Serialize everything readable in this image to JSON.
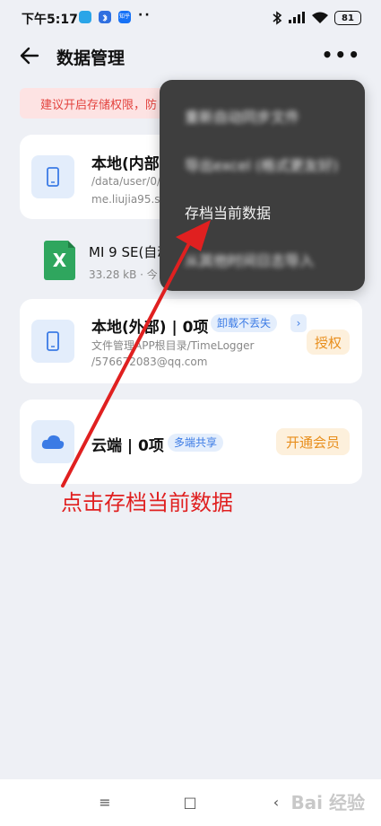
{
  "status_bar": {
    "time": "下午5:17",
    "dots": "··",
    "battery": "81",
    "app_icons": [
      "app-blue-icon",
      "bluetooth-notify-icon",
      "zhihu-icon"
    ],
    "zhihu_label": "知乎"
  },
  "header": {
    "title": "数据管理",
    "more": "•••"
  },
  "banner": {
    "text": "建议开启存储权限，防"
  },
  "cards": {
    "local_internal": {
      "title": "本地(内部",
      "path": "/data/user/0/",
      "package": "me.liujia95.so"
    },
    "file": {
      "name": "MI 9 SE(自动",
      "meta": "33.28 kB · 今",
      "icon_letter": "X"
    },
    "local_external": {
      "title": "本地(外部) | 0项",
      "chip": "卸载不丢失",
      "chip_arrow": "›",
      "path": "文件管理APP根目录/TimeLogger",
      "account": "/576672083@qq.com",
      "action": "授权"
    },
    "cloud": {
      "title": "云端 | 0项",
      "chip": "多端共享",
      "action": "开通会员"
    }
  },
  "menu": {
    "items": [
      {
        "label": "重新自动同步文件"
      },
      {
        "label": "导出excel (格式更友好)"
      },
      {
        "label": "存档当前数据"
      },
      {
        "label": "从其他时间日志导入"
      }
    ]
  },
  "annotation": {
    "text": "点击存档当前数据"
  },
  "nav": {
    "menu": "≡",
    "home": "□",
    "back": "‹",
    "watermark": "Bai 经验"
  },
  "colors": {
    "accent_blue": "#3b7be5",
    "warning_red": "#e3423d",
    "orange": "#e88e1c",
    "annotation_red": "#e02020",
    "menu_bg": "#3e3e3e"
  }
}
